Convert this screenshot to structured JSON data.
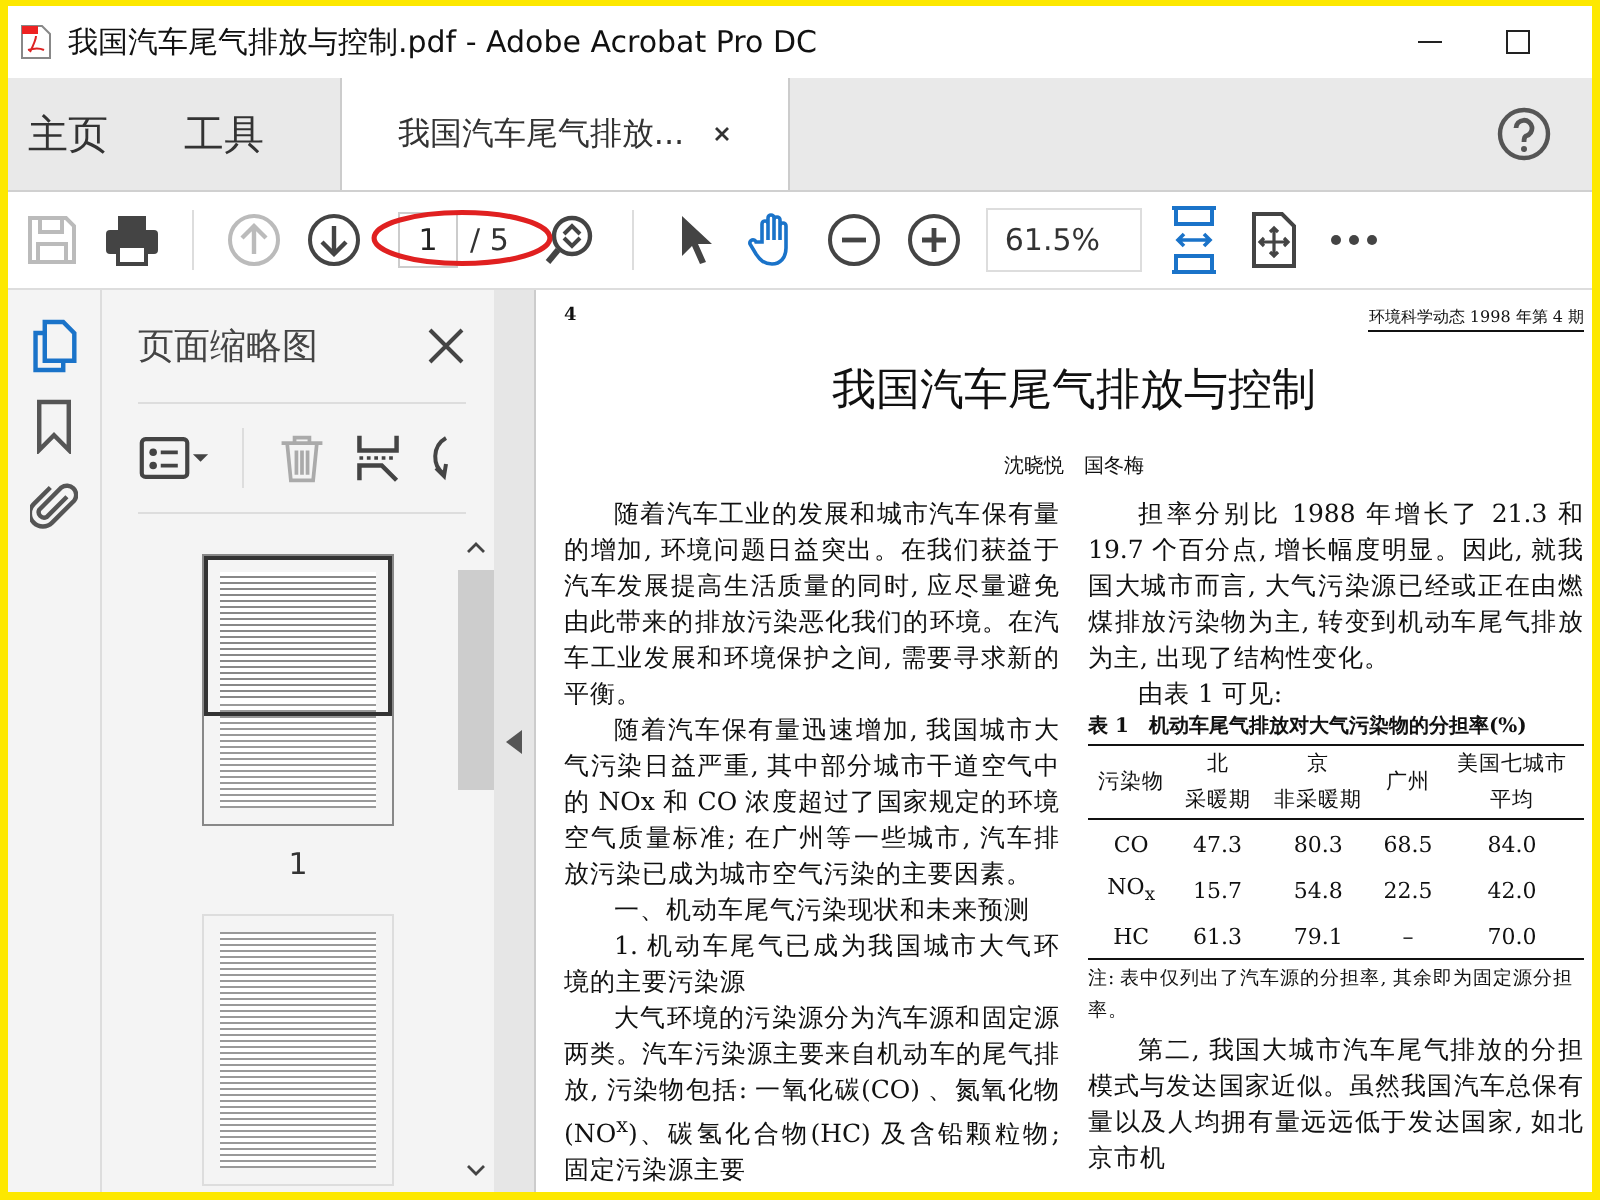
{
  "window": {
    "title": "我国汽车尾气排放与控制.pdf - Adobe Acrobat Pro DC"
  },
  "menu_tabs": [
    {
      "label": "主页",
      "selected": false
    },
    {
      "label": "工具",
      "selected": false
    }
  ],
  "document_tab": {
    "label": "我国汽车尾气排放...",
    "selected": true
  },
  "toolbar": {
    "file_buttons": [
      {
        "kind": "save",
        "disabled": true
      },
      {
        "kind": "print",
        "disabled": false
      }
    ],
    "page_buttons": [
      {
        "kind": "up",
        "disabled": true
      },
      {
        "kind": "down",
        "disabled": false
      }
    ],
    "page_number": "1",
    "page_total": "/ 5",
    "circled": true,
    "tools": [
      {
        "kind": "select",
        "selected": false
      },
      {
        "kind": "hand",
        "selected": true
      }
    ],
    "zoom": "61.5%"
  },
  "rail": [
    {
      "kind": "pages",
      "selected": true
    },
    {
      "kind": "bookmark",
      "selected": false
    },
    {
      "kind": "attachment",
      "selected": false
    }
  ],
  "side_panel": {
    "title": "页面缩略图",
    "tools": [
      {
        "kind": "options",
        "disabled": false
      },
      {
        "kind": "delete",
        "disabled": true
      },
      {
        "kind": "insert",
        "disabled": false
      },
      {
        "kind": "rotate",
        "disabled": false
      }
    ],
    "thumbnails": [
      {
        "label": "1",
        "selected": true
      },
      {
        "selected": false
      }
    ]
  },
  "document": {
    "page_number": "4",
    "journal": "环境科学动态 1998 年第 4 期",
    "title": "我国汽车尾气排放与控制",
    "authors": "沈晓悦　国冬梅",
    "left_column": [
      {
        "kind": "paragraph",
        "text": "随着汽车工业的发展和城市汽车保有量的增加, 环境问题日益突出。在我们获益于汽车发展提高生活质量的同时, 应尽量避免由此带来的排放污染恶化我们的环境。在汽车工业发展和环境保护之间, 需要寻求新的平衡。"
      },
      {
        "kind": "paragraph",
        "text": "随着汽车保有量迅速增加, 我国城市大气污染日益严重, 其中部分城市干道空气中的 NOx 和 CO 浓度超过了国家规定的环境空气质量标准; 在广州等一些城市, 汽车排放污染已成为城市空气污染的主要因素。"
      },
      {
        "kind": "heading",
        "text": "一、机动车尾气污染现状和未来预测"
      },
      {
        "kind": "paragraph",
        "text": "1. 机动车尾气已成为我国城市大气环境的主要污染源"
      },
      {
        "kind": "paragraph",
        "text": "大气环境的污染源分为汽车源和固定源两类。汽车污染源主要来自机动车的尾气排放, 污染物包括: 一氧化碳(CO) 、氮氧化物(NO$^{x}$)、碳氢化合物(HC) 及含铅颗粒物; 固定污染源主要"
      }
    ],
    "right_column": [
      {
        "kind": "paragraph",
        "text": "担率分别比 1988 年增长了 21.3 和 19.7 个百分点, 增长幅度明显。因此, 就我国大城市而言, 大气污染源已经或正在由燃煤排放污染物为主, 转变到机动车尾气排放为主, 出现了结构性变化。"
      },
      {
        "kind": "paragraph",
        "text": "由表 1 可见:"
      },
      {
        "kind": "table",
        "caption": "表 1　机动车尾气排放对大气污染物的分担率(%)",
        "pollutant_header": "污染物",
        "beijing_header": [
          "北",
          "京"
        ],
        "subheaders": [
          "采暖期",
          "非采暖期"
        ],
        "guangzhou_header": "广州",
        "us_header": [
          "美国七城市",
          "平均"
        ],
        "rows": [
          [
            "CO",
            "47.3",
            "80.3",
            "68.5",
            "84.0"
          ],
          [
            "NO$_{x}$",
            "15.7",
            "54.8",
            "22.5",
            "42.0"
          ],
          [
            "HC",
            "61.3",
            "79.1",
            "–",
            "70.0"
          ]
        ]
      },
      {
        "kind": "note",
        "text": "注: 表中仅列出了汽车源的分担率, 其余即为固定源分担率。"
      },
      {
        "kind": "paragraph",
        "text": "第二, 我国大城市汽车尾气排放的分担模式与发达国家近似。虽然我国汽车总保有量以及人均拥有量远远低于发达国家, 如北京市机"
      }
    ]
  }
}
